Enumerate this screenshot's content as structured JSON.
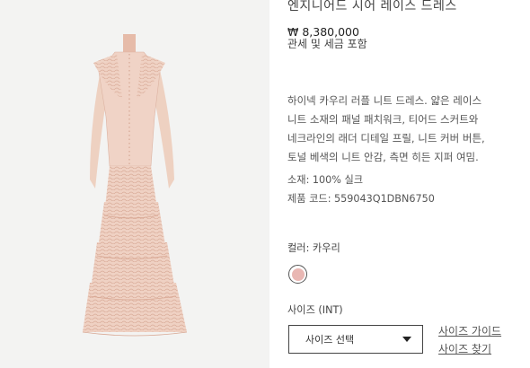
{
  "product": {
    "title": "엔지니어드 시어 레이스 드레스",
    "price": "₩ 8,380,000",
    "tax_note": "관세 및 세금 포함",
    "description_lines": [
      "하이넥 카우리 러플 니트 드레스. 얇은 레이스",
      "니트 소재의 패널 패치워크, 티어드 스커트와",
      "네크라인의 래더 디테일 프릴, 니트 커버 버튼,",
      "토널 베색의 니트 안감, 측면 히든 지퍼 여밈."
    ],
    "material": "소재: 100% 실크",
    "product_code": "제품 코드:  559043Q1DBN6750"
  },
  "color": {
    "label": "컬러: 카우리",
    "swatch_hex": "#e9b7b3"
  },
  "size": {
    "label": "사이즈  (INT)",
    "select_value": "사이즈 선택",
    "guide_link": "사이즈 가이드",
    "find_link": "사이즈 찾기"
  },
  "image": {
    "background_hex": "#f3f3f2",
    "dress_hex": "#edcbbd"
  }
}
